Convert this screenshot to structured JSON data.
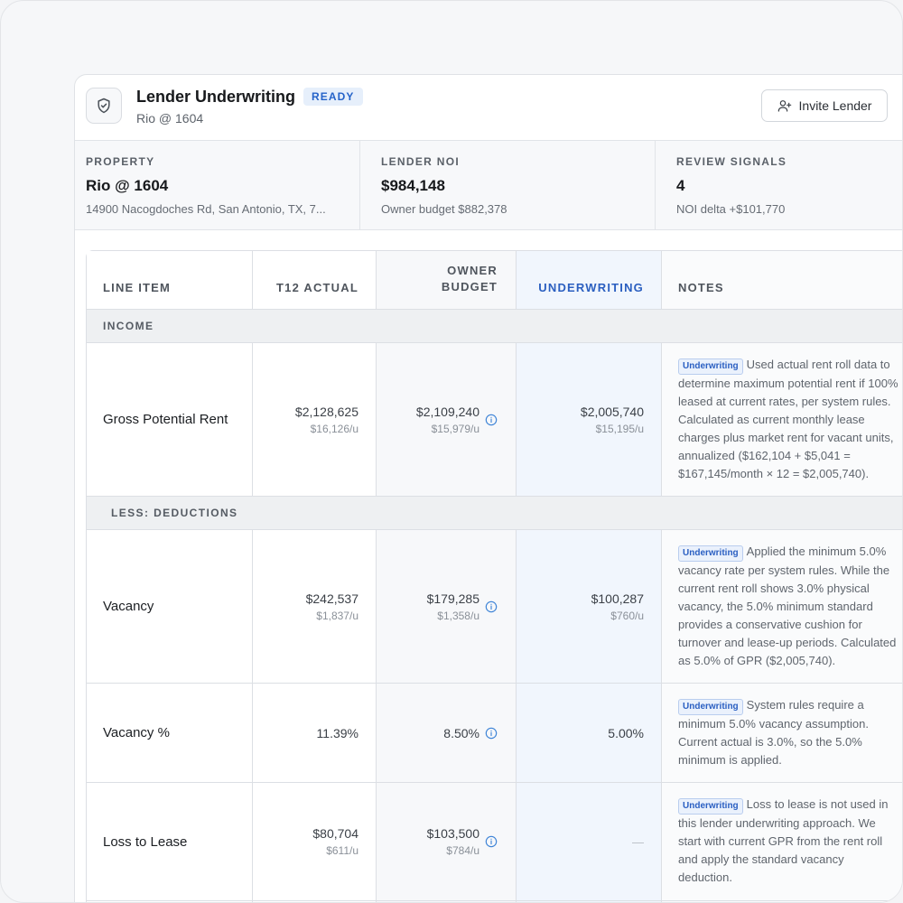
{
  "header": {
    "title": "Lender Underwriting",
    "badge": "READY",
    "subtitle": "Rio @ 1604",
    "invite_label": "Invite Lender"
  },
  "stats": [
    {
      "label": "PROPERTY",
      "value": "Rio @ 1604",
      "sub": "14900 Nacogdoches Rd, San Antonio, TX, 7..."
    },
    {
      "label": "LENDER NOI",
      "value": "$984,148",
      "sub": "Owner budget $882,378"
    },
    {
      "label": "REVIEW SIGNALS",
      "value": "4",
      "sub": "NOI delta +$101,770"
    }
  ],
  "table": {
    "columns": {
      "line_item": "LINE ITEM",
      "t12": "T12 ACTUAL",
      "owner_1": "OWNER",
      "owner_2": "BUDGET",
      "uw": "UNDERWRITING",
      "notes": "NOTES"
    },
    "sections": {
      "income": "INCOME",
      "deductions": "LESS: DEDUCTIONS"
    },
    "tag": "Underwriting",
    "rows": {
      "gpr": {
        "label": "Gross Potential Rent",
        "t12": "$2,128,625",
        "t12_sub": "$16,126/u",
        "owner": "$2,109,240",
        "owner_sub": "$15,979/u",
        "uw": "$2,005,740",
        "uw_sub": "$15,195/u",
        "notes": [
          "Used actual rent roll data to",
          "determine maximum potential rent if 100%",
          "leased at current rates, per system rules.",
          "Calculated as current monthly lease",
          "charges plus market rent for vacant units,",
          "annualized ($162,104 + $5,041 =",
          "$167,145/month × 12 = $2,005,740)."
        ]
      },
      "vacancy": {
        "label": "Vacancy",
        "t12": "$242,537",
        "t12_sub": "$1,837/u",
        "owner": "$179,285",
        "owner_sub": "$1,358/u",
        "uw": "$100,287",
        "uw_sub": "$760/u",
        "notes": [
          "Applied the minimum 5.0%",
          "vacancy rate per system rules. While the",
          "current rent roll shows 3.0% physical",
          "vacancy, the 5.0% minimum standard",
          "provides a conservative cushion for",
          "turnover and lease-up periods. Calculated",
          "as 5.0% of GPR ($2,005,740)."
        ]
      },
      "vacancy_pct": {
        "label": "Vacancy %",
        "t12": "11.39%",
        "owner": "8.50%",
        "uw": "5.00%",
        "notes": [
          "System rules require a",
          "minimum 5.0% vacancy assumption.",
          "Current actual is 3.0%, so the 5.0%",
          "minimum is applied."
        ]
      },
      "ltl": {
        "label": "Loss to Lease",
        "t12": "$80,704",
        "t12_sub": "$611/u",
        "owner": "$103,500",
        "owner_sub": "$784/u",
        "uw": "—",
        "notes": [
          "Loss to lease is not used in",
          "this lender underwriting approach. We",
          "start with current GPR from the rent roll",
          "and apply the standard vacancy",
          "deduction."
        ]
      }
    }
  },
  "colors": {
    "accent": "#2563c9",
    "uw_column": "#f1f6fd",
    "badge_bg": "#e6effb"
  },
  "icons": [
    "shield-check-icon",
    "user-plus-icon",
    "info-icon"
  ]
}
